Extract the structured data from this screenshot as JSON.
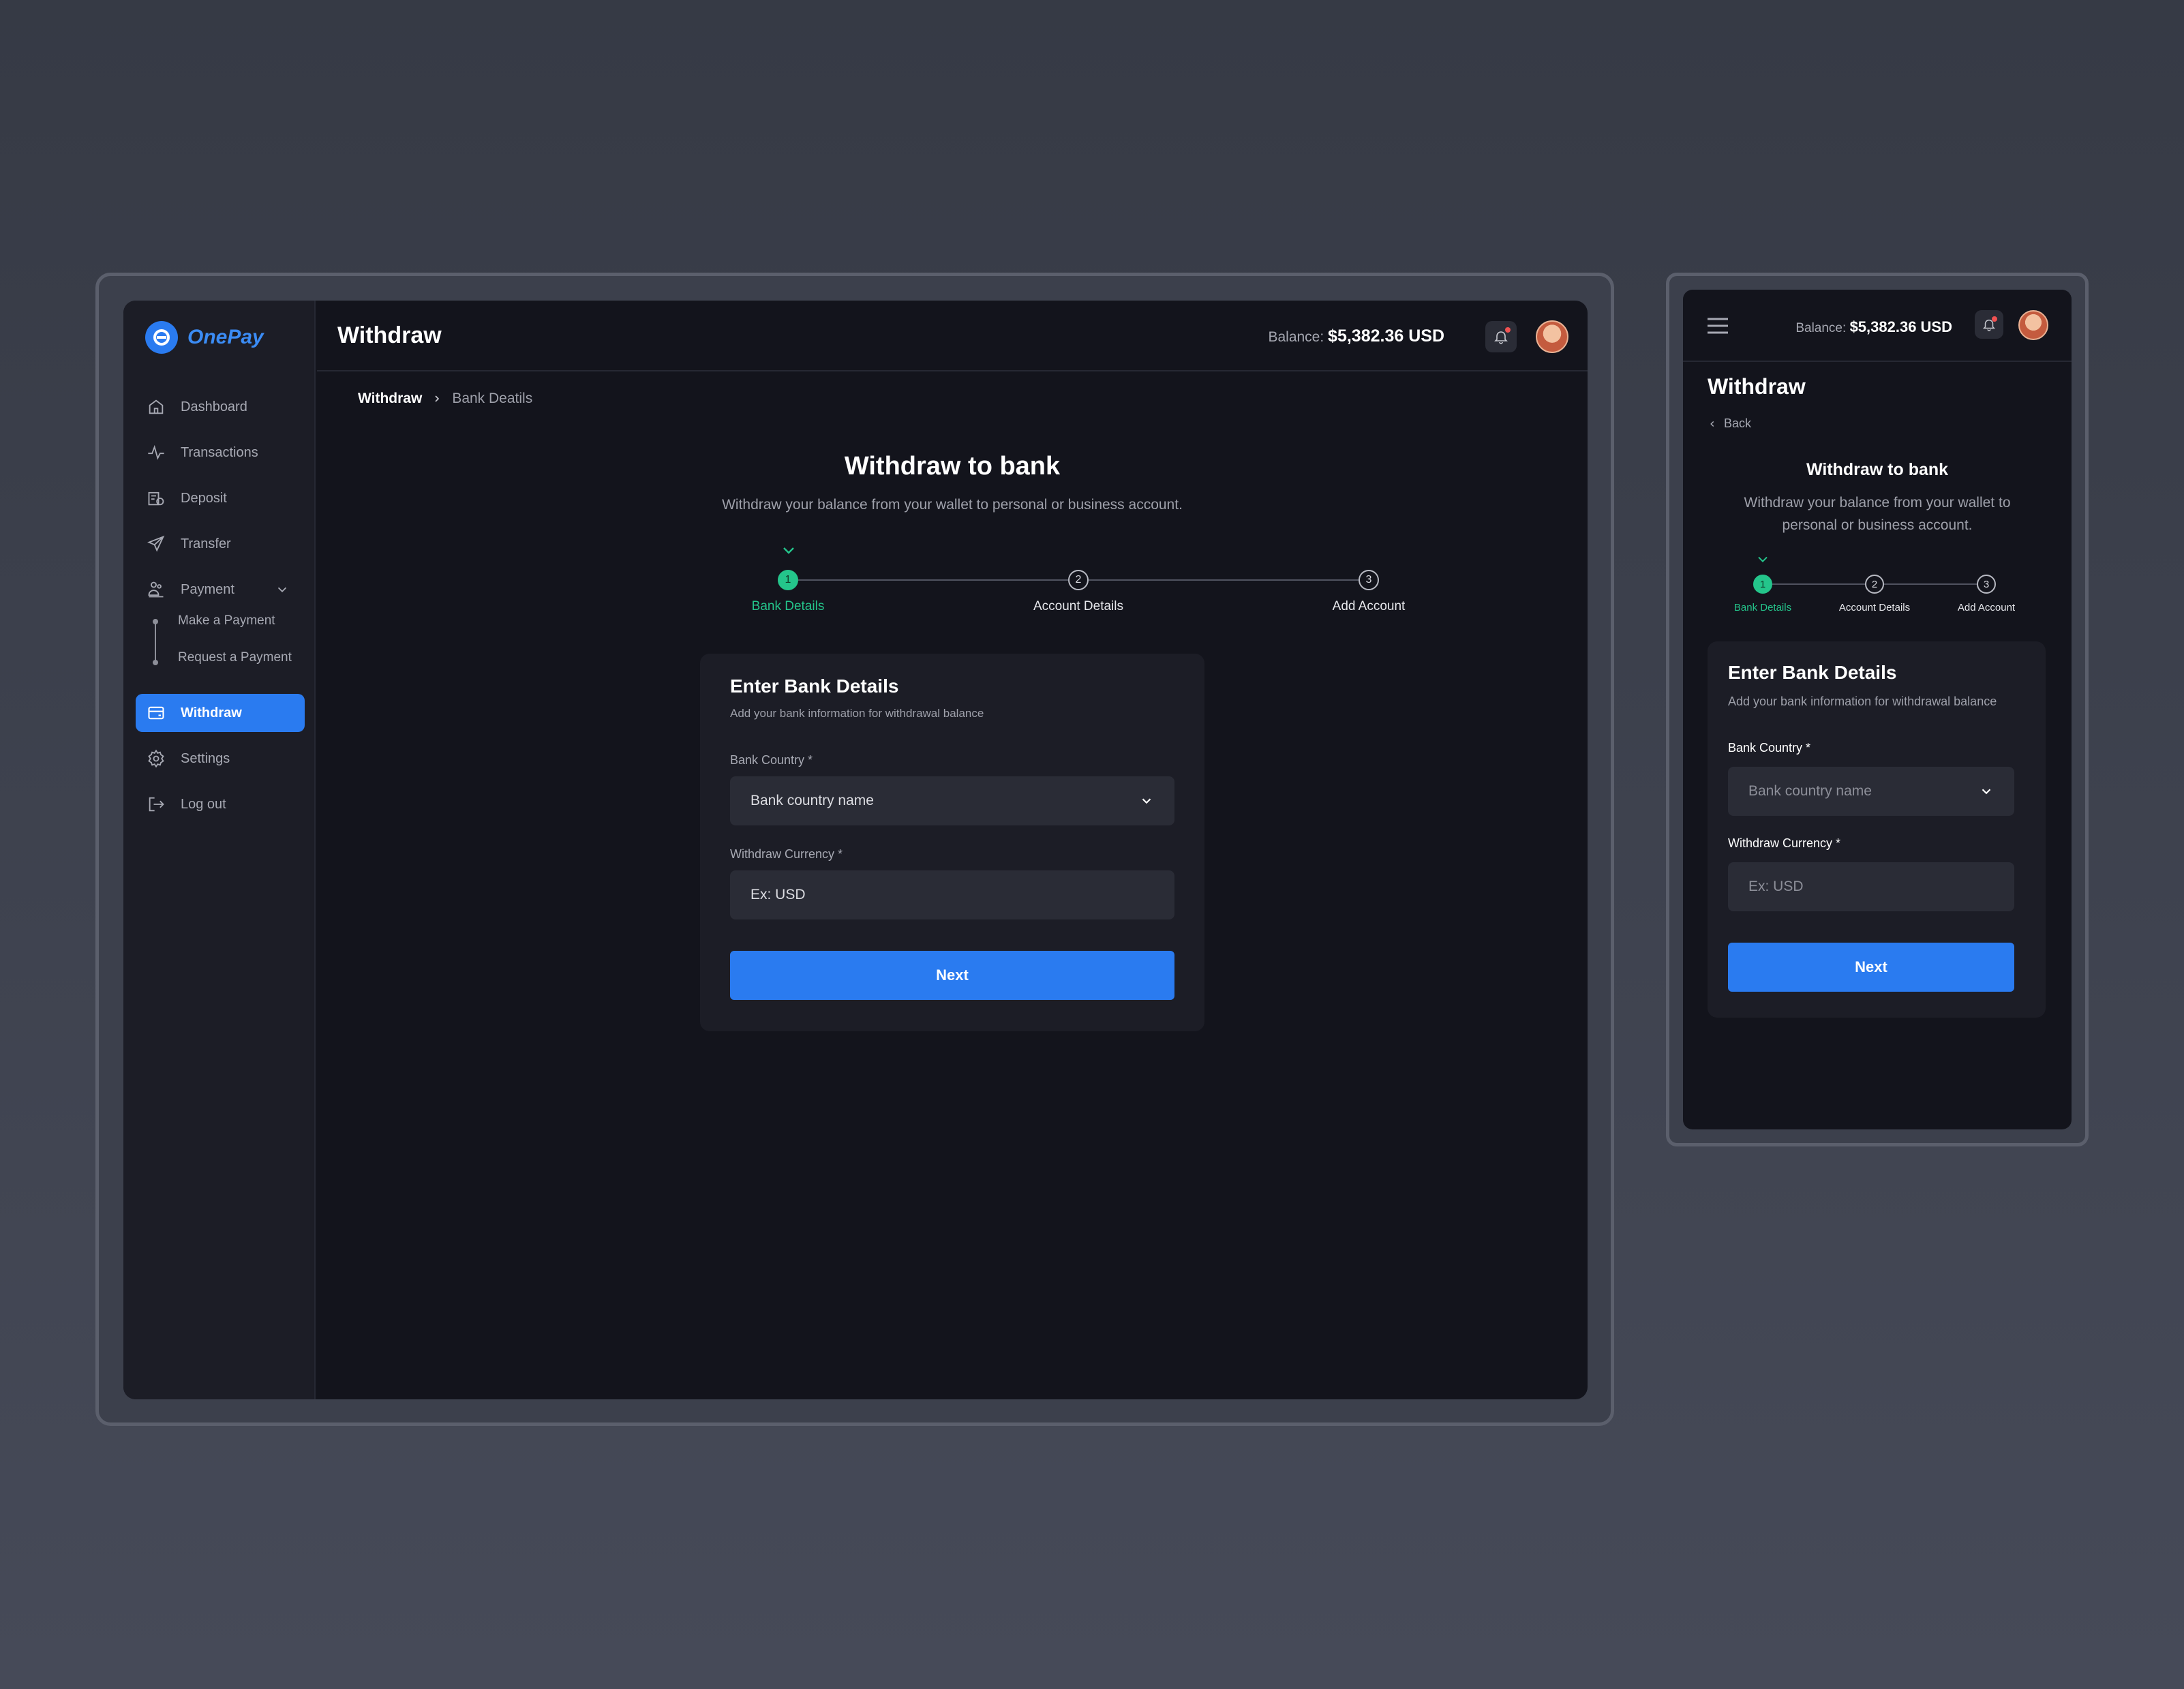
{
  "app": {
    "name": "OnePay",
    "brand_color": "#2a7bf0",
    "success_color": "#24c58b"
  },
  "sidebar": {
    "items": [
      {
        "label": "Dashboard",
        "icon": "home-icon"
      },
      {
        "label": "Transactions",
        "icon": "activity-icon"
      },
      {
        "label": "Deposit",
        "icon": "deposit-icon"
      },
      {
        "label": "Transfer",
        "icon": "send-icon"
      },
      {
        "label": "Payment",
        "icon": "payment-icon",
        "expanded": true,
        "children": [
          "Make a Payment",
          "Request a Payment"
        ]
      },
      {
        "label": "Withdraw",
        "icon": "wallet-icon",
        "active": true
      },
      {
        "label": "Settings",
        "icon": "gear-icon"
      },
      {
        "label": "Log out",
        "icon": "logout-icon"
      }
    ]
  },
  "header": {
    "title": "Withdraw",
    "balance_label": "Balance:",
    "balance_value": "$5,382.36 USD",
    "notification_icon": "bell-icon",
    "has_notification": true
  },
  "breadcrumb": {
    "current": "Withdraw",
    "next": "Bank Deatils"
  },
  "hero": {
    "title": "Withdraw to bank",
    "subtitle": "Withdraw your balance from your wallet to personal or business account."
  },
  "stepper": {
    "steps": [
      {
        "number": "1",
        "label": "Bank Details",
        "state": "current"
      },
      {
        "number": "2",
        "label": "Account Details",
        "state": "pending"
      },
      {
        "number": "3",
        "label": "Add Account",
        "state": "pending"
      }
    ]
  },
  "form": {
    "title": "Enter Bank Details",
    "subtitle": "Add your bank information for withdrawal balance",
    "country_label": "Bank Country *",
    "country_value": "Bank country name",
    "currency_label": "Withdraw Currency *",
    "currency_placeholder": "Ex: USD",
    "next_label": "Next"
  },
  "mobile": {
    "menu_icon": "hamburger-icon",
    "back_label": "Back",
    "subtitle_line1": "Withdraw your balance from your wallet to",
    "subtitle_line2": "personal or business account."
  }
}
